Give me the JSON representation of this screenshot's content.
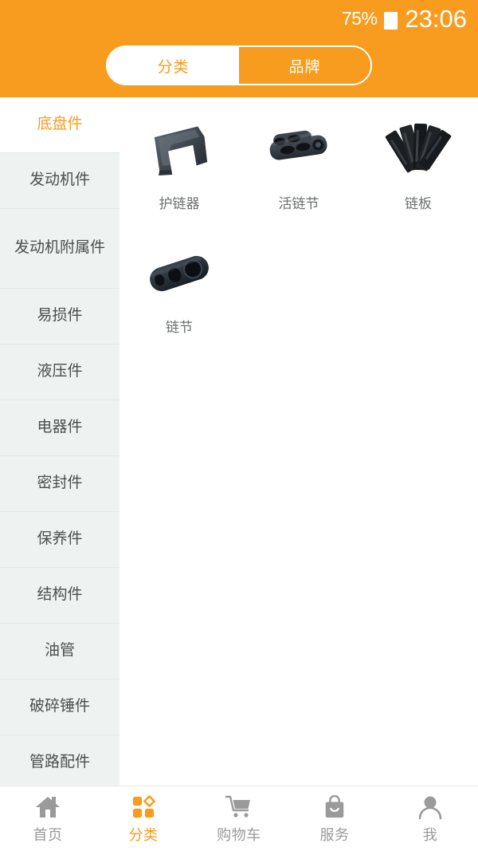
{
  "status_bar": {
    "battery_percent": "75%",
    "battery_icon": "battery-icon",
    "time": "23:06"
  },
  "header": {
    "background_color": "#f79c1e",
    "segmented_control": {
      "active_index": 0,
      "options": [
        {
          "label": "分类",
          "active": true
        },
        {
          "label": "品牌",
          "active": false
        }
      ]
    }
  },
  "sidebar": {
    "active_index": 0,
    "items": [
      {
        "label": "底盘件",
        "active": true
      },
      {
        "label": "发动机件",
        "active": false
      },
      {
        "label": "发动机附属件",
        "active": false
      },
      {
        "label": "易损件",
        "active": false
      },
      {
        "label": "液压件",
        "active": false
      },
      {
        "label": "电器件",
        "active": false
      },
      {
        "label": "密封件",
        "active": false
      },
      {
        "label": "保养件",
        "active": false
      },
      {
        "label": "结构件",
        "active": false
      },
      {
        "label": "油管",
        "active": false
      },
      {
        "label": "破碎锤件",
        "active": false
      },
      {
        "label": "管路配件",
        "active": false
      }
    ]
  },
  "products": [
    {
      "label": "护链器",
      "icon": "chain-guard-icon"
    },
    {
      "label": "活链节",
      "icon": "master-link-icon"
    },
    {
      "label": "链板",
      "icon": "track-shoe-icon"
    },
    {
      "label": "链节",
      "icon": "chain-link-icon"
    }
  ],
  "tabbar": {
    "active_index": 1,
    "accent_color": "#f79c1e",
    "inactive_color": "#9a9a9a",
    "items": [
      {
        "label": "首页",
        "icon": "home-icon"
      },
      {
        "label": "分类",
        "icon": "grid-categories-icon"
      },
      {
        "label": "购物车",
        "icon": "shopping-cart-icon"
      },
      {
        "label": "服务",
        "icon": "shopping-bag-icon"
      },
      {
        "label": "我",
        "icon": "person-icon"
      }
    ]
  }
}
